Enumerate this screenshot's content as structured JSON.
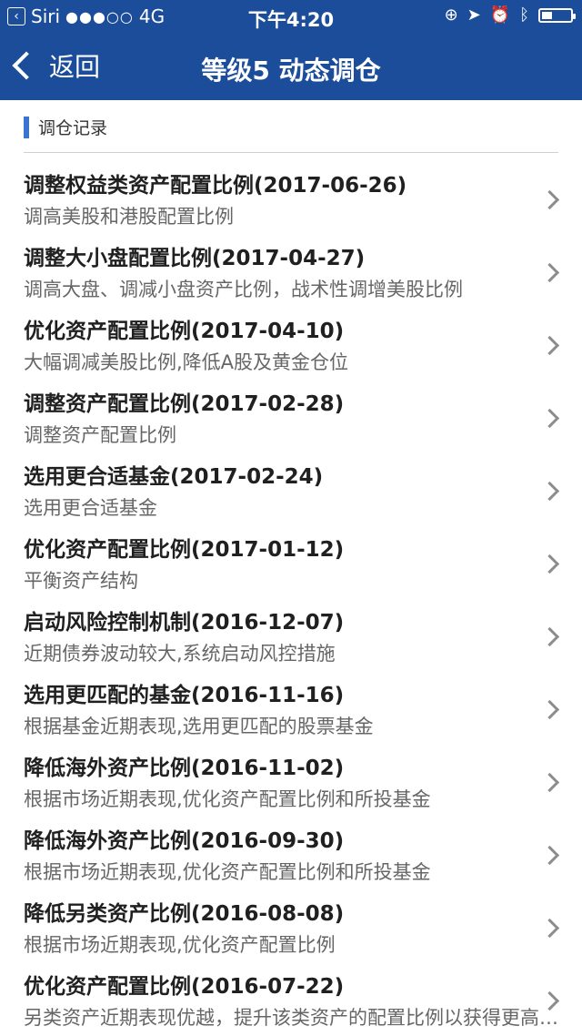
{
  "status_bar": {
    "back_app": "Siri",
    "signal": "●●●○○",
    "network": "4G",
    "time": "下午4:20",
    "battery_level": 0.35
  },
  "nav": {
    "back_label": "返回",
    "title": "等级5 动态调仓"
  },
  "section": {
    "label": "调仓记录"
  },
  "records": [
    {
      "title": "调整权益类资产配置比例(2017-06-26)",
      "subtitle": "调高美股和港股配置比例"
    },
    {
      "title": "调整大小盘配置比例(2017-04-27)",
      "subtitle": "调高大盘、调减小盘资产比例，战术性调增美股比例"
    },
    {
      "title": "优化资产配置比例(2017-04-10)",
      "subtitle": "大幅调减美股比例,降低A股及黄金仓位"
    },
    {
      "title": "调整资产配置比例(2017-02-28)",
      "subtitle": "调整资产配置比例"
    },
    {
      "title": "选用更合适基金(2017-02-24)",
      "subtitle": "选用更合适基金"
    },
    {
      "title": "优化资产配置比例(2017-01-12)",
      "subtitle": "平衡资产结构"
    },
    {
      "title": "启动风险控制机制(2016-12-07)",
      "subtitle": "近期债券波动较大,系统启动风控措施"
    },
    {
      "title": "选用更匹配的基金(2016-11-16)",
      "subtitle": "根据基金近期表现,选用更匹配的股票基金"
    },
    {
      "title": "降低海外资产比例(2016-11-02)",
      "subtitle": "根据市场近期表现,优化资产配置比例和所投基金"
    },
    {
      "title": "降低海外资产比例(2016-09-30)",
      "subtitle": "根据市场近期表现,优化资产配置比例和所投基金"
    },
    {
      "title": "降低另类资产比例(2016-08-08)",
      "subtitle": "根据市场近期表现,优化资产配置比例"
    },
    {
      "title": "优化资产配置比例(2016-07-22)",
      "subtitle": "另类资产近期表现优越，提升该类资产的配置比例以获得更高收益"
    }
  ]
}
